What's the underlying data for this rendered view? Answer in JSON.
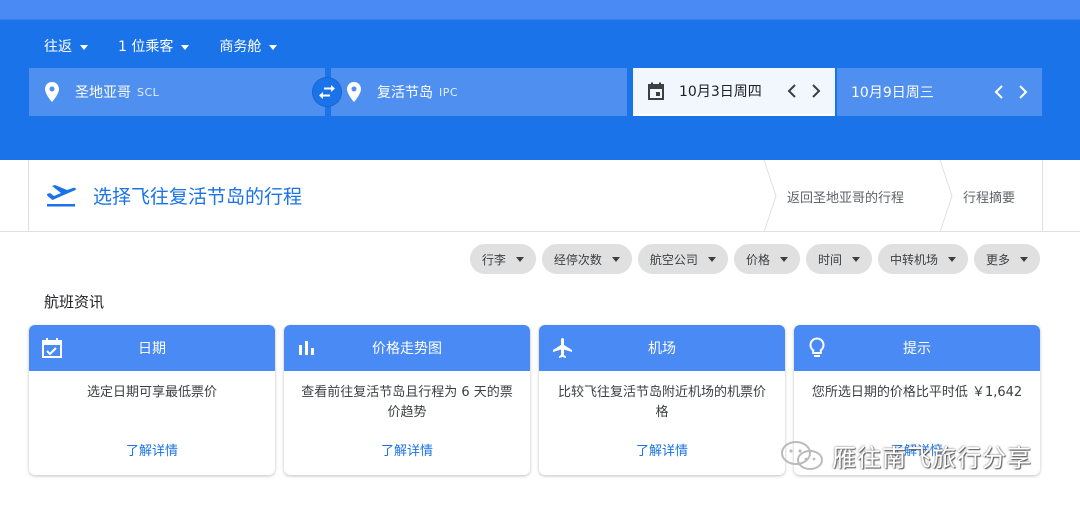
{
  "header": {
    "trip_type": "往返",
    "passengers": "1 位乘客",
    "cabin": "商务舱",
    "origin": {
      "city": "圣地亚哥",
      "code": "SCL"
    },
    "destination": {
      "city": "复活节岛",
      "code": "IPC"
    },
    "depart_date": "10月3日周四",
    "return_date": "10月9日周三"
  },
  "step": {
    "title": "选择飞往复活节岛的行程",
    "crumbs": [
      "返回圣地亚哥的行程",
      "行程摘要"
    ]
  },
  "filters": [
    "行李",
    "经停次数",
    "航空公司",
    "价格",
    "时间",
    "中转机场",
    "更多"
  ],
  "section_title": "航班资讯",
  "cards": [
    {
      "title": "日期",
      "icon": "calendar-check-icon",
      "body": "选定日期可享最低票价",
      "link": "了解详情"
    },
    {
      "title": "价格走势图",
      "icon": "bar-chart-icon",
      "body": "查看前往复活节岛且行程为 6 天的票价趋势",
      "link": "了解详情"
    },
    {
      "title": "机场",
      "icon": "airplane-icon",
      "body": "比较飞往复活节岛附近机场的机票价格",
      "link": "了解详情"
    },
    {
      "title": "提示",
      "icon": "lightbulb-icon",
      "body": "您所选日期的价格比平时低 ￥1,642",
      "link": "了解详情"
    }
  ],
  "watermark": "雁往南飞旅行分享",
  "colors": {
    "primary": "#1a73e8",
    "field": "#4f8ff0",
    "card_head": "#4a8af4",
    "chip": "#e0e0e0"
  }
}
